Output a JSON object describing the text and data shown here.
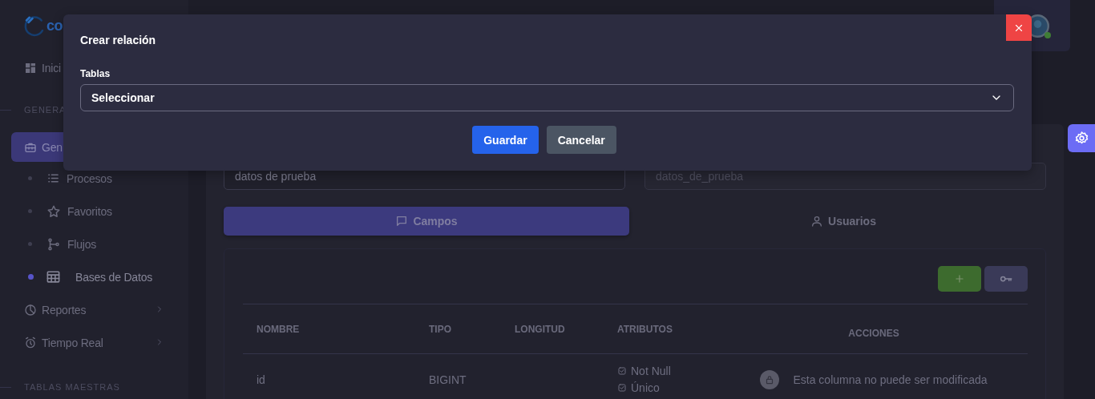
{
  "sidebar": {
    "logo_text": "co",
    "items": [
      {
        "kind": "item",
        "label": "Inici",
        "selected": false
      },
      {
        "kind": "section",
        "label": "GENERA"
      },
      {
        "kind": "item",
        "label": "Gen",
        "selected": true
      },
      {
        "kind": "subitem",
        "label": "Procesos",
        "selected": false
      },
      {
        "kind": "subitem",
        "label": "Favoritos",
        "selected": false
      },
      {
        "kind": "subitem",
        "label": "Flujos",
        "selected": false
      },
      {
        "kind": "subitem",
        "label": "Bases de Datos",
        "selected": true
      },
      {
        "kind": "group",
        "label": "Reportes",
        "expanded": false
      },
      {
        "kind": "group",
        "label": "Tiempo Real",
        "expanded": false
      },
      {
        "kind": "section",
        "label": "TABLAS MAESTRAS"
      }
    ]
  },
  "user": {
    "online": true
  },
  "form": {
    "name_field": {
      "value": "datos de prueba",
      "disabled": false
    },
    "table_name_field": {
      "value": "datos_de_prueba",
      "disabled": true
    }
  },
  "tabs": [
    {
      "label": "Campos",
      "selected": true
    },
    {
      "label": "Usuarios",
      "selected": false
    }
  ],
  "table": {
    "columns": [
      "NOMBRE",
      "TIPO",
      "LONGITUD",
      "ATRIBUTOS",
      "ACCIONES"
    ],
    "rows": [
      {
        "name": "id",
        "type": "BIGINT",
        "attributes": [
          {
            "label": "Not Null",
            "checked": true
          },
          {
            "label": "Único",
            "checked": true
          }
        ],
        "locked": true,
        "action_note": "Esta columna no puede ser modificada"
      }
    ]
  },
  "modal": {
    "title": "Crear relación",
    "field": {
      "label": "Tablas",
      "value": "Seleccionar"
    },
    "buttons": [
      {
        "label": "Guardar",
        "kind": "primary"
      },
      {
        "label": "Cancelar",
        "kind": "secondary"
      }
    ]
  }
}
